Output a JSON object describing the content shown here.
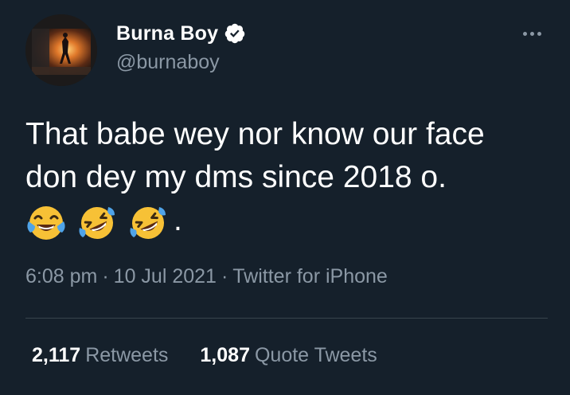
{
  "user": {
    "display_name": "Burna Boy",
    "handle": "@burnaboy",
    "verified": true
  },
  "tweet": {
    "lines": [
      "That babe wey nor know our face",
      "don dey my dms since 2018 o."
    ],
    "emojis": [
      "face-with-tears-of-joy-icon",
      "rolling-on-the-floor-laughing-icon",
      "rolling-on-the-floor-laughing-icon"
    ],
    "trailing": "."
  },
  "meta": {
    "time": "6:08 pm",
    "sep1": "·",
    "date": "10 Jul 2021",
    "sep2": "·",
    "source": "Twitter for iPhone"
  },
  "stats": {
    "retweets_count": "2,117",
    "retweets_label": "Retweets",
    "quotes_count": "1,087",
    "quotes_label": "Quote Tweets"
  },
  "colors": {
    "background": "#15202b",
    "text": "#ffffff",
    "secondary": "#8b98a5",
    "divider": "#38444d",
    "verified": "#ffffff"
  }
}
